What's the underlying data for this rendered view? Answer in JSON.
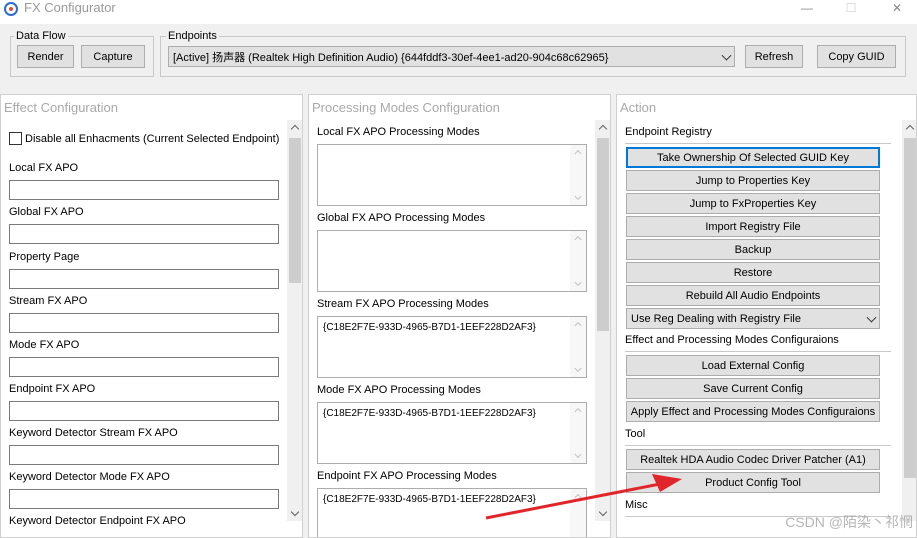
{
  "window": {
    "title": "FX Configurator",
    "controls": {
      "minimize": "—",
      "maximize": "☐",
      "close": "✕"
    }
  },
  "dataflow": {
    "label": "Data Flow",
    "render_label": "Render",
    "capture_label": "Capture"
  },
  "endpoints": {
    "label": "Endpoints",
    "selected": "[Active] 扬声器 (Realtek High Definition Audio) {644fddf3-30ef-4ee1-ad20-904c68c62965}",
    "refresh_label": "Refresh",
    "copy_guid_label": "Copy GUID"
  },
  "effect_config": {
    "title": "Effect Configuration",
    "disable_all_label": "Disable all Enhacments (Current Selected Endpoint)",
    "fields": [
      {
        "label": "Local FX APO",
        "value": ""
      },
      {
        "label": "Global FX APO",
        "value": ""
      },
      {
        "label": "Property Page",
        "value": ""
      },
      {
        "label": "Stream FX APO",
        "value": ""
      },
      {
        "label": "Mode FX APO",
        "value": ""
      },
      {
        "label": "Endpoint FX APO",
        "value": ""
      },
      {
        "label": "Keyword Detector Stream FX APO",
        "value": ""
      },
      {
        "label": "Keyword Detector Mode FX APO",
        "value": ""
      },
      {
        "label": "Keyword Detector Endpoint FX APO",
        "value": ""
      }
    ]
  },
  "processing_modes": {
    "title": "Processing Modes Configuration",
    "sections": [
      {
        "label": "Local FX APO Processing Modes",
        "value": ""
      },
      {
        "label": "Global FX APO Processing Modes",
        "value": ""
      },
      {
        "label": "Stream FX APO Processing Modes",
        "value": "{C18E2F7E-933D-4965-B7D1-1EEF228D2AF3}"
      },
      {
        "label": "Mode FX APO Processing Modes",
        "value": "{C18E2F7E-933D-4965-B7D1-1EEF228D2AF3}"
      },
      {
        "label": "Endpoint FX APO Processing Modes",
        "value": "{C18E2F7E-933D-4965-B7D1-1EEF228D2AF3}"
      }
    ]
  },
  "action": {
    "title": "Action",
    "endpoint_registry": {
      "label": "Endpoint Registry",
      "buttons": [
        "Take Ownership Of Selected GUID Key",
        "Jump to Properties Key",
        "Jump to FxProperties Key",
        "Import Registry File",
        "Backup",
        "Restore",
        "Rebuild All Audio Endpoints"
      ],
      "reg_dealing_selected": "Use Reg Dealing with Registry File"
    },
    "effect_processing": {
      "label": "Effect and Processing Modes Configuraions",
      "buttons": [
        "Load External Config",
        "Save Current Config",
        "Apply Effect and Processing Modes Configuraions"
      ]
    },
    "tool": {
      "label": "Tool",
      "buttons": [
        "Realtek HDA Audio Codec Driver Patcher (A1)",
        "Product Config Tool"
      ]
    },
    "misc": {
      "label": "Misc"
    }
  },
  "annotation": {
    "arrow_color": "#e0262b"
  },
  "watermark": {
    "text": "CSDN @陌染丶祁惘"
  },
  "colors": {
    "focus_border": "#0078d7",
    "panel_title": "#a9a9a9"
  }
}
